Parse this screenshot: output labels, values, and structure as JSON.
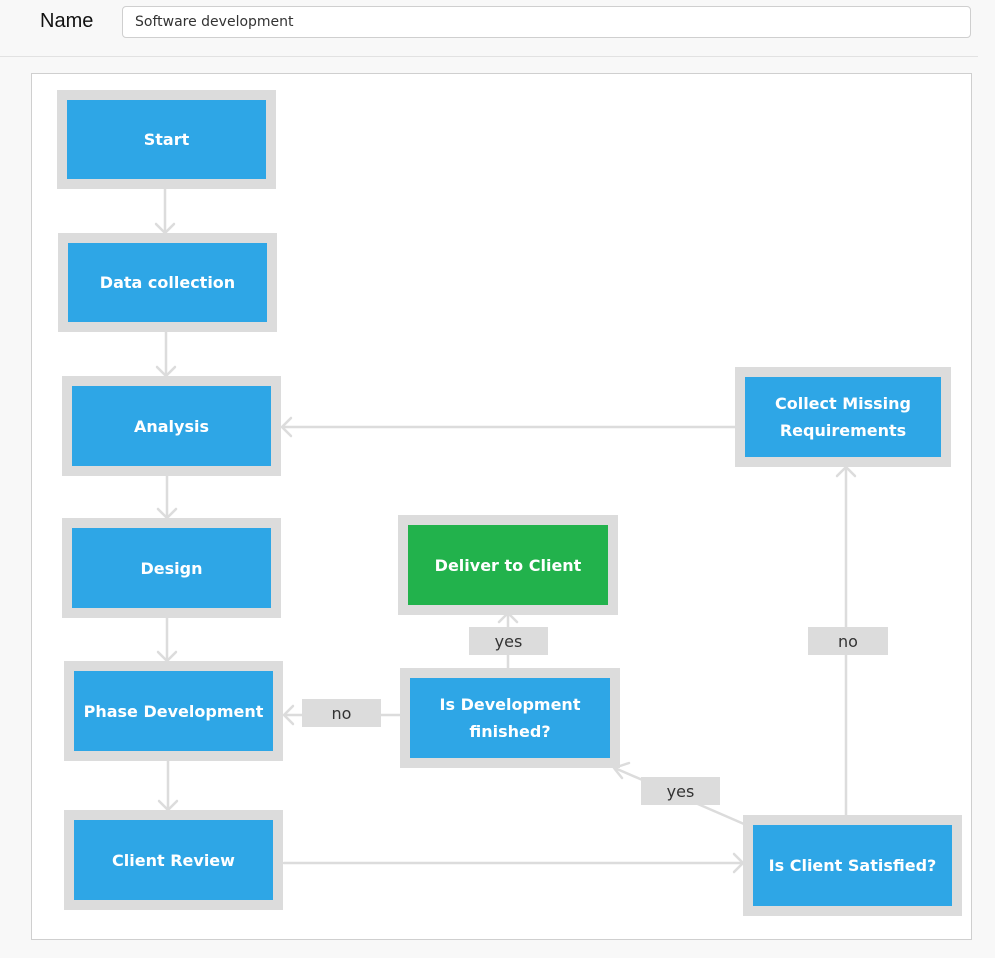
{
  "form": {
    "name_label": "Name",
    "name_value": "Software development"
  },
  "colors": {
    "node_fill": "#2ea6e6",
    "node_terminal_fill": "#22b24c",
    "node_border": "#dcdcdc",
    "edge": "#dcdcdc"
  },
  "diagram": {
    "nodes": {
      "start": "Start",
      "data_collection": "Data collection",
      "analysis": "Analysis",
      "design": "Design",
      "phase_development": "Phase Development",
      "client_review": "Client Review",
      "collect_missing": "Collect Missing Requirements",
      "deliver": "Deliver to Client",
      "is_dev_finished": "Is Development finished?",
      "is_client_satisfied": "Is Client Satisfied?"
    },
    "edge_labels": {
      "dev_finished_yes": "yes",
      "dev_finished_no": "no",
      "satisfied_yes": "yes",
      "satisfied_no": "no"
    }
  }
}
